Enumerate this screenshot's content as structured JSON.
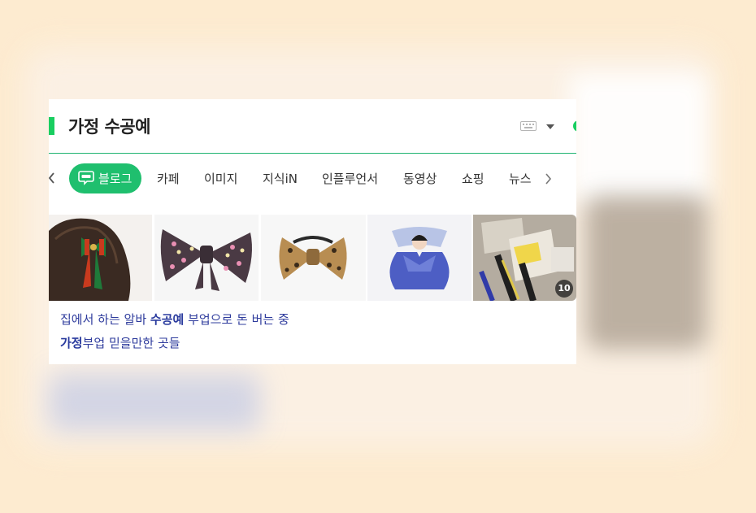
{
  "search": {
    "title": "가정 수공예"
  },
  "tabs": {
    "active": {
      "label": "블로그",
      "icon": "blog-icon"
    },
    "items": [
      {
        "label": "카페"
      },
      {
        "label": "이미지"
      },
      {
        "label": "지식iN"
      },
      {
        "label": "인플루언서"
      },
      {
        "label": "동영상"
      },
      {
        "label": "쇼핑"
      },
      {
        "label": "뉴스"
      }
    ]
  },
  "images": {
    "count_badge": "10"
  },
  "results": [
    {
      "pre": "집에서 하는 알바 ",
      "bold": "수공예",
      "post": " 부업으로 돈 버는 중"
    },
    {
      "pre": "",
      "bold": "가정",
      "post": "부업 믿을만한 곳들"
    }
  ],
  "colors": {
    "accent": "#19ce60",
    "link": "#2f3c9d",
    "background": "#fdebd0"
  }
}
